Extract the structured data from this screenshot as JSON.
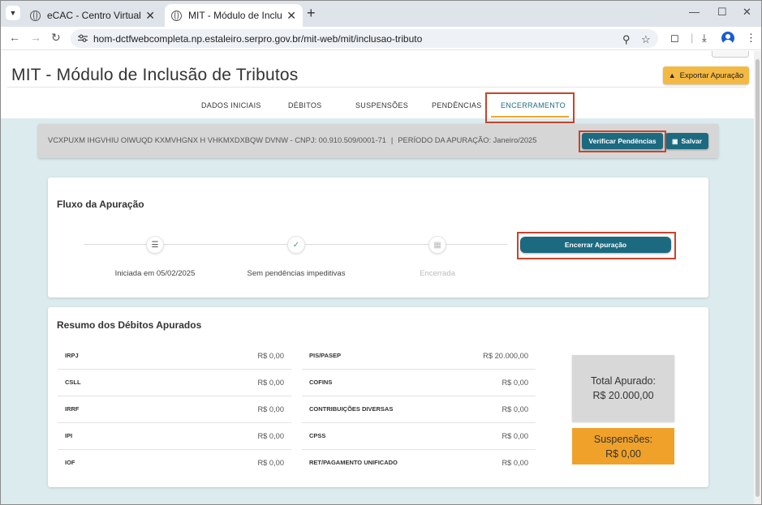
{
  "browser": {
    "tabs": [
      {
        "label": "eCAC - Centro Virtual de Atendi"
      },
      {
        "label": "MIT - Módulo de Inclusão de Tri"
      }
    ],
    "url": "hom-dctfwebcompleta.np.estaleiro.serpro.gov.br/mit-web/mit/inclusao-tributo"
  },
  "header": {
    "title": "MIT - Módulo de Inclusão de Tributos",
    "export_label": "Exportar Apuração"
  },
  "nav_tabs": [
    "DADOS INICIAIS",
    "DÉBITOS",
    "SUSPENSÕES",
    "PENDÊNCIAS",
    "ENCERRAMENTO"
  ],
  "active_tab": "ENCERRAMENTO",
  "info_bar": {
    "company": "VCXPUXM IHGVHIU OIWUQD KXMVHGNX H VHKMXDXBQW DVNW - CNPJ: 00.910.509/0001-71",
    "separator": "|",
    "period": "PERÍODO DA APURAÇÃO: Janeiro/2025",
    "verify_label": "Verificar Pendências",
    "save_label": "Salvar"
  },
  "flow": {
    "title": "Fluxo da Apuração",
    "steps": [
      {
        "label": "Iniciada em 05/02/2025",
        "icon": "list-icon"
      },
      {
        "label": "Sem pendências impeditivas",
        "icon": "check-icon"
      },
      {
        "label": "Encerrada",
        "icon": "clipboard-icon"
      }
    ],
    "close_label": "Encerrar Apuração"
  },
  "summary": {
    "title": "Resumo dos Débitos Apurados",
    "left": [
      {
        "label": "IRPJ",
        "value": "R$ 0,00"
      },
      {
        "label": "CSLL",
        "value": "R$ 0,00"
      },
      {
        "label": "IRRF",
        "value": "R$ 0,00"
      },
      {
        "label": "IPI",
        "value": "R$ 0,00"
      },
      {
        "label": "IOF",
        "value": "R$ 0,00"
      }
    ],
    "right": [
      {
        "label": "PIS/PASEP",
        "value": "R$ 20.000,00"
      },
      {
        "label": "COFINS",
        "value": "R$ 0,00"
      },
      {
        "label": "CONTRIBUIÇÕES DIVERSAS",
        "value": "R$ 0,00"
      },
      {
        "label": "CPSS",
        "value": "R$ 0,00"
      },
      {
        "label": "RET/PAGAMENTO UNIFICADO",
        "value": "R$ 0,00"
      }
    ],
    "total_label": "Total Apurado:",
    "total_value": "R$ 20.000,00",
    "susp_label": "Suspensões:",
    "susp_value": "R$ 0,00"
  },
  "colors": {
    "primary": "#1c6a80",
    "accent": "#f0a12a",
    "highlight": "#c8442b"
  }
}
